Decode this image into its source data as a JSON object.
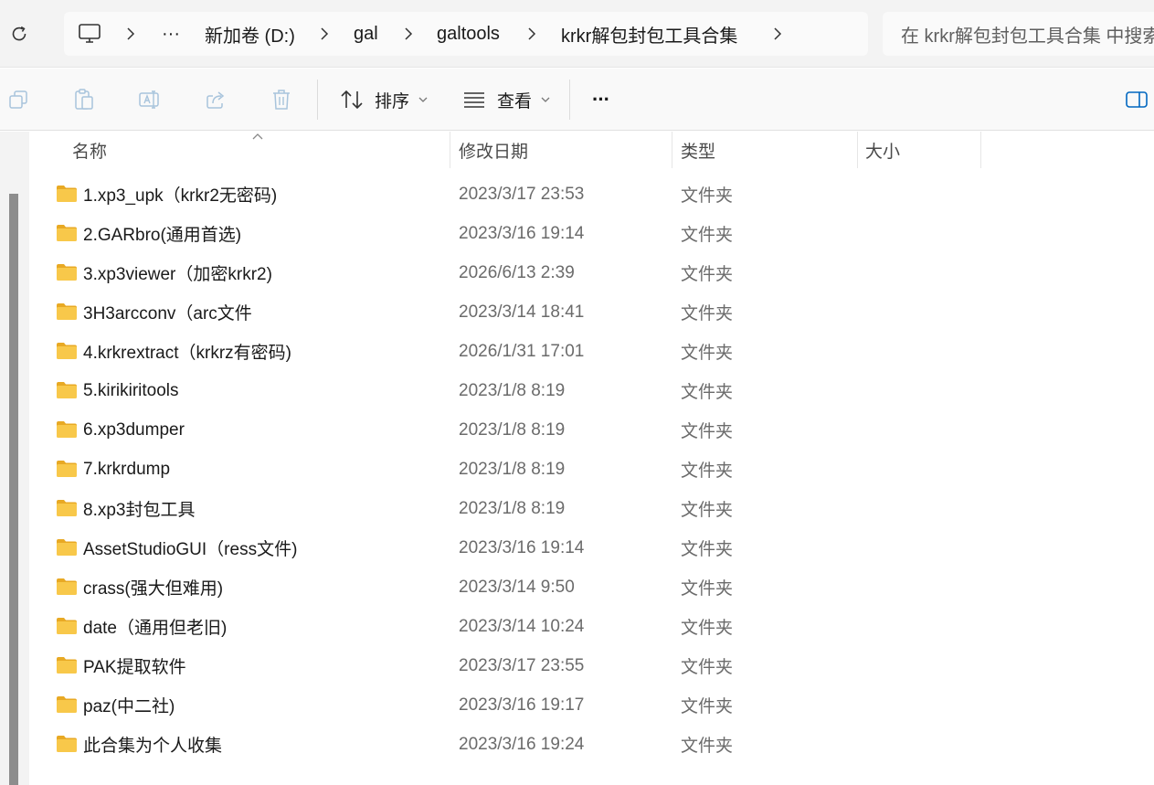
{
  "breadcrumb": {
    "overflow": "···",
    "items": [
      "新加卷 (D:)",
      "gal",
      "galtools",
      "krkr解包封包工具合集"
    ]
  },
  "search": {
    "placeholder": "在 krkr解包封包工具合集 中搜索"
  },
  "toolbar": {
    "sort_label": "排序",
    "view_label": "查看",
    "more_label": "···"
  },
  "columns": {
    "name": "名称",
    "modified": "修改日期",
    "type": "类型",
    "size": "大小"
  },
  "colors": {
    "folder_yellow": "#f8c84a",
    "folder_dark": "#e8a924",
    "accent": "#0067c0"
  },
  "files": [
    {
      "name": "1.xp3_upk（krkr2无密码)",
      "modified": "2023/3/17 23:53",
      "type": "文件夹"
    },
    {
      "name": "2.GARbro(通用首选)",
      "modified": "2023/3/16 19:14",
      "type": "文件夹"
    },
    {
      "name": "3.xp3viewer（加密krkr2)",
      "modified": "2026/6/13 2:39",
      "type": "文件夹"
    },
    {
      "name": "3H3arcconv（arc文件",
      "modified": "2023/3/14 18:41",
      "type": "文件夹"
    },
    {
      "name": "4.krkrextract（krkrz有密码)",
      "modified": "2026/1/31 17:01",
      "type": "文件夹"
    },
    {
      "name": "5.kirikiritools",
      "modified": "2023/1/8 8:19",
      "type": "文件夹"
    },
    {
      "name": "6.xp3dumper",
      "modified": "2023/1/8 8:19",
      "type": "文件夹"
    },
    {
      "name": "7.krkrdump",
      "modified": "2023/1/8 8:19",
      "type": "文件夹"
    },
    {
      "name": "8.xp3封包工具",
      "modified": "2023/1/8 8:19",
      "type": "文件夹"
    },
    {
      "name": "AssetStudioGUI（ress文件)",
      "modified": "2023/3/16 19:14",
      "type": "文件夹"
    },
    {
      "name": "crass(强大但难用)",
      "modified": "2023/3/14 9:50",
      "type": "文件夹"
    },
    {
      "name": "date（通用但老旧)",
      "modified": "2023/3/14 10:24",
      "type": "文件夹"
    },
    {
      "name": "PAK提取软件",
      "modified": "2023/3/17 23:55",
      "type": "文件夹"
    },
    {
      "name": "paz(中二社)",
      "modified": "2023/3/16 19:17",
      "type": "文件夹"
    },
    {
      "name": "此合集为个人收集",
      "modified": "2023/3/16 19:24",
      "type": "文件夹"
    }
  ]
}
